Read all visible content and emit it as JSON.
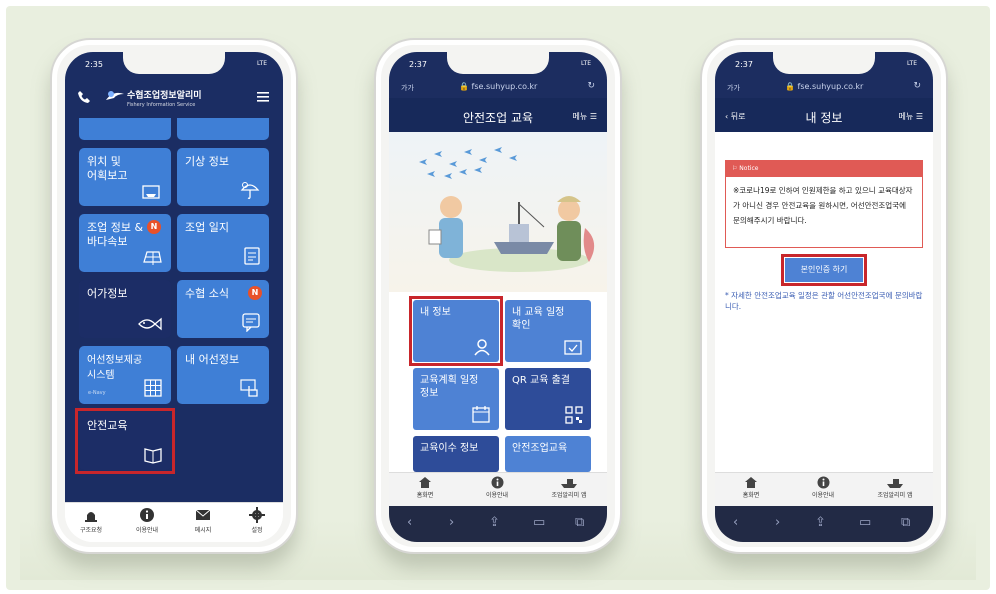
{
  "phone1": {
    "status_time": "2:35",
    "status_right": "LTE",
    "app_title": "수협조업정보알리미",
    "app_subtitle": "Fishery Information Service",
    "tiles": [
      {
        "label": "위치 및\n어획보고",
        "icon": "boat-report-icon"
      },
      {
        "label": "기상 정보",
        "icon": "umbrella-icon"
      },
      {
        "label": "조업 정보 &\n바다속보",
        "icon": "solar-panel-icon",
        "badge": "N"
      },
      {
        "label": "조업 일지",
        "icon": "journal-icon"
      },
      {
        "label": "어가정보",
        "icon": "fish-icon"
      },
      {
        "label": "수협 소식",
        "icon": "chat-icon",
        "badge": "N"
      },
      {
        "label": "어선정보제공\n시스템",
        "icon": "grid-icon",
        "sub": "e-Navy"
      },
      {
        "label": "내 어선정보",
        "icon": "tap-icon"
      },
      {
        "label": "안전교육",
        "icon": "book-icon"
      }
    ],
    "tabbar": [
      "구조요청",
      "이용안내",
      "메시지",
      "설정"
    ]
  },
  "phone2": {
    "status_time": "2:37",
    "status_right": "LTE",
    "browser_left": "가가",
    "url": "fse.suhyup.co.kr",
    "title": "안전조업 교육",
    "menu": "메뉴",
    "menu_tiles": [
      {
        "label": "내 정보",
        "icon": "person-icon"
      },
      {
        "label": "내 교육 일정\n확인",
        "icon": "calendar-check-icon"
      },
      {
        "label": "교육계획 일정\n정보",
        "icon": "calendar-icon"
      },
      {
        "label": "QR 교육 출결",
        "icon": "qr-icon"
      },
      {
        "label": "교육이수 정보",
        "icon": ""
      },
      {
        "label": "안전조업교육",
        "icon": ""
      }
    ],
    "footer": [
      "홈화면",
      "이용안내",
      "조업알리미 앱"
    ]
  },
  "phone3": {
    "status_time": "2:37",
    "status_right": "LTE",
    "browser_left": "가가",
    "url": "fse.suhyup.co.kr",
    "back": "뒤로",
    "title": "내 정보",
    "menu": "메뉴",
    "notice_header": "Notice",
    "notice_body": "※코로나19로 인하여 인원제한을 하고 있으니 교육대상자가 아니신 경우 안전교육을 원하시면, 어선안전조업국에 문의해주시기 바랍니다.",
    "auth_button": "본인인증 하기",
    "footnote": "* 자세한 안전조업교육 일정은 관할 어선안전조업국에 문의바랍니다.",
    "footer": [
      "홈화면",
      "이용안내",
      "조업알리미 앱"
    ]
  },
  "colors": {
    "navy": "#1b2d63",
    "tile_blue": "#3f7fd6",
    "highlight_red": "#c8262b",
    "notice_red": "#e05a55"
  }
}
